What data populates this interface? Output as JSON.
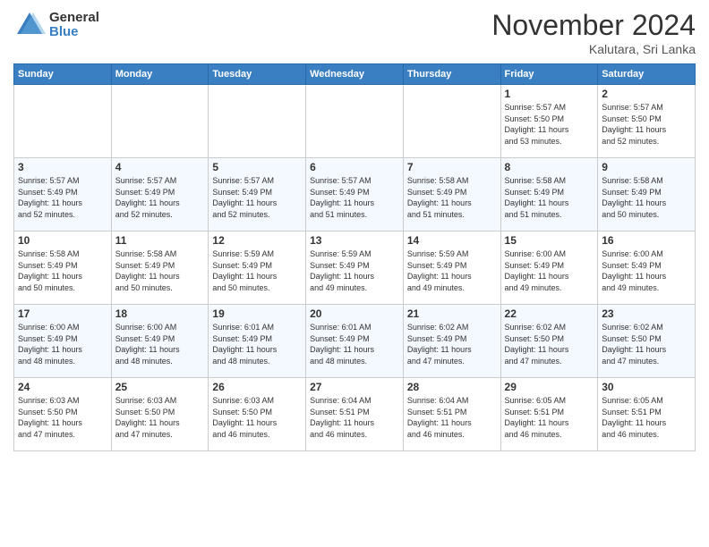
{
  "header": {
    "logo": {
      "general": "General",
      "blue": "Blue"
    },
    "month": "November 2024",
    "location": "Kalutara, Sri Lanka"
  },
  "weekdays": [
    "Sunday",
    "Monday",
    "Tuesday",
    "Wednesday",
    "Thursday",
    "Friday",
    "Saturday"
  ],
  "weeks": [
    [
      {
        "day": "",
        "info": ""
      },
      {
        "day": "",
        "info": ""
      },
      {
        "day": "",
        "info": ""
      },
      {
        "day": "",
        "info": ""
      },
      {
        "day": "",
        "info": ""
      },
      {
        "day": "1",
        "info": "Sunrise: 5:57 AM\nSunset: 5:50 PM\nDaylight: 11 hours\nand 53 minutes."
      },
      {
        "day": "2",
        "info": "Sunrise: 5:57 AM\nSunset: 5:50 PM\nDaylight: 11 hours\nand 52 minutes."
      }
    ],
    [
      {
        "day": "3",
        "info": "Sunrise: 5:57 AM\nSunset: 5:49 PM\nDaylight: 11 hours\nand 52 minutes."
      },
      {
        "day": "4",
        "info": "Sunrise: 5:57 AM\nSunset: 5:49 PM\nDaylight: 11 hours\nand 52 minutes."
      },
      {
        "day": "5",
        "info": "Sunrise: 5:57 AM\nSunset: 5:49 PM\nDaylight: 11 hours\nand 52 minutes."
      },
      {
        "day": "6",
        "info": "Sunrise: 5:57 AM\nSunset: 5:49 PM\nDaylight: 11 hours\nand 51 minutes."
      },
      {
        "day": "7",
        "info": "Sunrise: 5:58 AM\nSunset: 5:49 PM\nDaylight: 11 hours\nand 51 minutes."
      },
      {
        "day": "8",
        "info": "Sunrise: 5:58 AM\nSunset: 5:49 PM\nDaylight: 11 hours\nand 51 minutes."
      },
      {
        "day": "9",
        "info": "Sunrise: 5:58 AM\nSunset: 5:49 PM\nDaylight: 11 hours\nand 50 minutes."
      }
    ],
    [
      {
        "day": "10",
        "info": "Sunrise: 5:58 AM\nSunset: 5:49 PM\nDaylight: 11 hours\nand 50 minutes."
      },
      {
        "day": "11",
        "info": "Sunrise: 5:58 AM\nSunset: 5:49 PM\nDaylight: 11 hours\nand 50 minutes."
      },
      {
        "day": "12",
        "info": "Sunrise: 5:59 AM\nSunset: 5:49 PM\nDaylight: 11 hours\nand 50 minutes."
      },
      {
        "day": "13",
        "info": "Sunrise: 5:59 AM\nSunset: 5:49 PM\nDaylight: 11 hours\nand 49 minutes."
      },
      {
        "day": "14",
        "info": "Sunrise: 5:59 AM\nSunset: 5:49 PM\nDaylight: 11 hours\nand 49 minutes."
      },
      {
        "day": "15",
        "info": "Sunrise: 6:00 AM\nSunset: 5:49 PM\nDaylight: 11 hours\nand 49 minutes."
      },
      {
        "day": "16",
        "info": "Sunrise: 6:00 AM\nSunset: 5:49 PM\nDaylight: 11 hours\nand 49 minutes."
      }
    ],
    [
      {
        "day": "17",
        "info": "Sunrise: 6:00 AM\nSunset: 5:49 PM\nDaylight: 11 hours\nand 48 minutes."
      },
      {
        "day": "18",
        "info": "Sunrise: 6:00 AM\nSunset: 5:49 PM\nDaylight: 11 hours\nand 48 minutes."
      },
      {
        "day": "19",
        "info": "Sunrise: 6:01 AM\nSunset: 5:49 PM\nDaylight: 11 hours\nand 48 minutes."
      },
      {
        "day": "20",
        "info": "Sunrise: 6:01 AM\nSunset: 5:49 PM\nDaylight: 11 hours\nand 48 minutes."
      },
      {
        "day": "21",
        "info": "Sunrise: 6:02 AM\nSunset: 5:49 PM\nDaylight: 11 hours\nand 47 minutes."
      },
      {
        "day": "22",
        "info": "Sunrise: 6:02 AM\nSunset: 5:50 PM\nDaylight: 11 hours\nand 47 minutes."
      },
      {
        "day": "23",
        "info": "Sunrise: 6:02 AM\nSunset: 5:50 PM\nDaylight: 11 hours\nand 47 minutes."
      }
    ],
    [
      {
        "day": "24",
        "info": "Sunrise: 6:03 AM\nSunset: 5:50 PM\nDaylight: 11 hours\nand 47 minutes."
      },
      {
        "day": "25",
        "info": "Sunrise: 6:03 AM\nSunset: 5:50 PM\nDaylight: 11 hours\nand 47 minutes."
      },
      {
        "day": "26",
        "info": "Sunrise: 6:03 AM\nSunset: 5:50 PM\nDaylight: 11 hours\nand 46 minutes."
      },
      {
        "day": "27",
        "info": "Sunrise: 6:04 AM\nSunset: 5:51 PM\nDaylight: 11 hours\nand 46 minutes."
      },
      {
        "day": "28",
        "info": "Sunrise: 6:04 AM\nSunset: 5:51 PM\nDaylight: 11 hours\nand 46 minutes."
      },
      {
        "day": "29",
        "info": "Sunrise: 6:05 AM\nSunset: 5:51 PM\nDaylight: 11 hours\nand 46 minutes."
      },
      {
        "day": "30",
        "info": "Sunrise: 6:05 AM\nSunset: 5:51 PM\nDaylight: 11 hours\nand 46 minutes."
      }
    ]
  ]
}
